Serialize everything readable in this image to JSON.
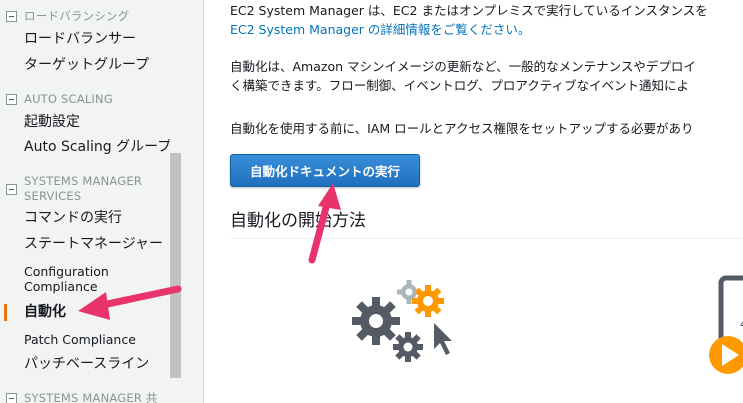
{
  "sidebar": {
    "sections": [
      {
        "header": "ロードバランシング",
        "items": [
          "ロードバランサー",
          "ターゲットグループ"
        ]
      },
      {
        "header": "AUTO SCALING",
        "items": [
          "起動設定",
          "Auto Scaling グループ"
        ]
      },
      {
        "header_lines": [
          "SYSTEMS MANAGER",
          "SERVICES"
        ],
        "items": [
          "コマンドの実行",
          "ステートマネージャー",
          "Configuration",
          "Compliance",
          "自動化",
          "Patch Compliance",
          "パッチベースライン"
        ]
      },
      {
        "header": "SYSTEMS MANAGER 共"
      }
    ],
    "active_item": "自動化"
  },
  "main": {
    "intro_line1": "EC2 System Manager は、EC2 またはオンプレミスで実行しているインスタンスを",
    "intro_link": "EC2 System Manager の詳細情報をご覧ください。",
    "desc_line1": "自動化は、Amazon マシンイメージの更新など、一般的なメンテナンスやデプロイ",
    "desc_line2": "く構築できます。フロー制御、イベントログ、プロアクティブなイベント通知によ",
    "prereq_line": "自動化を使用する前に、IAM ロールとアクセス権限をセットアップする必要があり",
    "run_button_label": "自動化ドキュメントの実行",
    "section_title": "自動化の開始方法"
  },
  "colors": {
    "accent_orange": "#ec7211",
    "link_blue": "#0073bb",
    "button_blue": "#1f6fbf",
    "annotation_pink": "#e8336d",
    "gear_dark": "#545b64",
    "gear_orange": "#f90"
  },
  "icons": [
    "collapse-icon",
    "gears-icon",
    "cursor-icon",
    "document-icon",
    "play-icon"
  ]
}
